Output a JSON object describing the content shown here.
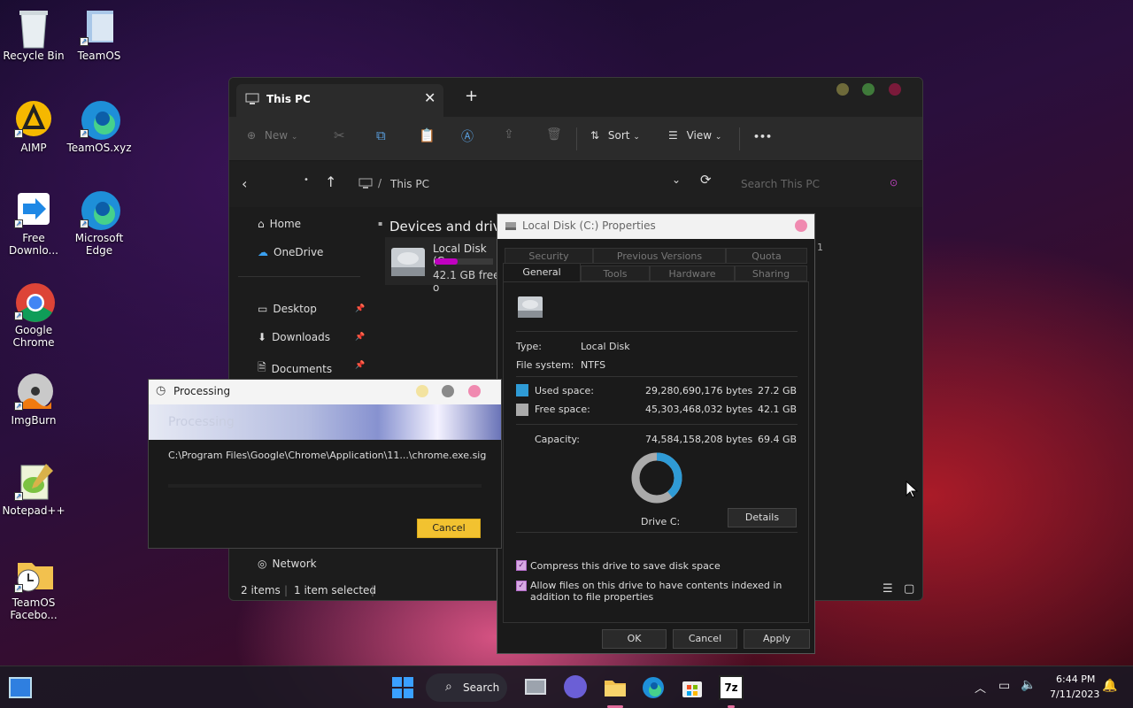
{
  "desktop": {
    "icons": [
      {
        "label": "Recycle Bin"
      },
      {
        "label": "TeamOS"
      },
      {
        "label": "AIMP"
      },
      {
        "label": "TeamOS.xyz"
      },
      {
        "label": "Free Downlo..."
      },
      {
        "label": "Microsoft Edge"
      },
      {
        "label": "Google Chrome"
      },
      {
        "label": "ImgBurn"
      },
      {
        "label": "Notepad++"
      },
      {
        "label": "TeamOS Facebo..."
      }
    ]
  },
  "explorer": {
    "tab_title": "This PC",
    "toolbar": {
      "new_label": "New",
      "sort_label": "Sort",
      "view_label": "View",
      "more_label": "•••"
    },
    "address": {
      "path": "This PC",
      "search_placeholder": "Search This PC"
    },
    "sidebar": {
      "items": [
        {
          "label": "Home",
          "icon": "home-icon"
        },
        {
          "label": "OneDrive",
          "icon": "cloud-icon"
        },
        {
          "label": "Desktop",
          "icon": "desktop-icon"
        },
        {
          "label": "Downloads",
          "icon": "download-icon"
        },
        {
          "label": "Documents",
          "icon": "documents-icon"
        },
        {
          "label": "Network",
          "icon": "network-icon"
        }
      ]
    },
    "section_title": "Devices and drives",
    "drive": {
      "name": "Local Disk (C:",
      "free": "42.1 GB free o",
      "usage_percent": 39,
      "bar_color": "#c000c0"
    },
    "status": {
      "items": "2 items",
      "selected": "1 item selected"
    }
  },
  "properties": {
    "title": "Local Disk (C:) Properties",
    "tabs_row1": [
      "Security",
      "Previous Versions",
      "Quota"
    ],
    "tabs_row2": [
      "General",
      "Tools",
      "Hardware",
      "Sharing"
    ],
    "type_label": "Type:",
    "type_value": "Local Disk",
    "fs_label": "File system:",
    "fs_value": "NTFS",
    "used_label": "Used space:",
    "used_bytes": "29,280,690,176 bytes",
    "used_size": "27.2 GB",
    "used_color": "#2f9bd6",
    "free_label": "Free space:",
    "free_bytes": "45,303,468,032 bytes",
    "free_size": "42.1 GB",
    "free_color": "#aaaaaa",
    "cap_label": "Capacity:",
    "cap_bytes": "74,584,158,208 bytes",
    "cap_size": "69.4 GB",
    "drive_label": "Drive C:",
    "details_label": "Details",
    "compress_label": "Compress this drive to save disk space",
    "index_label": "Allow files on this drive to have contents indexed in addition to file properties",
    "ok_label": "OK",
    "cancel_label": "Cancel",
    "apply_label": "Apply",
    "used_fraction": 0.393
  },
  "processing": {
    "title": "Processing",
    "banner_text": "Processing",
    "path": "C:\\Program Files\\Google\\Chrome\\Application\\11...\\chrome.exe.sig",
    "cancel_label": "Cancel"
  },
  "taskbar": {
    "search_label": "Search",
    "time": "6:44 PM",
    "date": "7/11/2023"
  }
}
